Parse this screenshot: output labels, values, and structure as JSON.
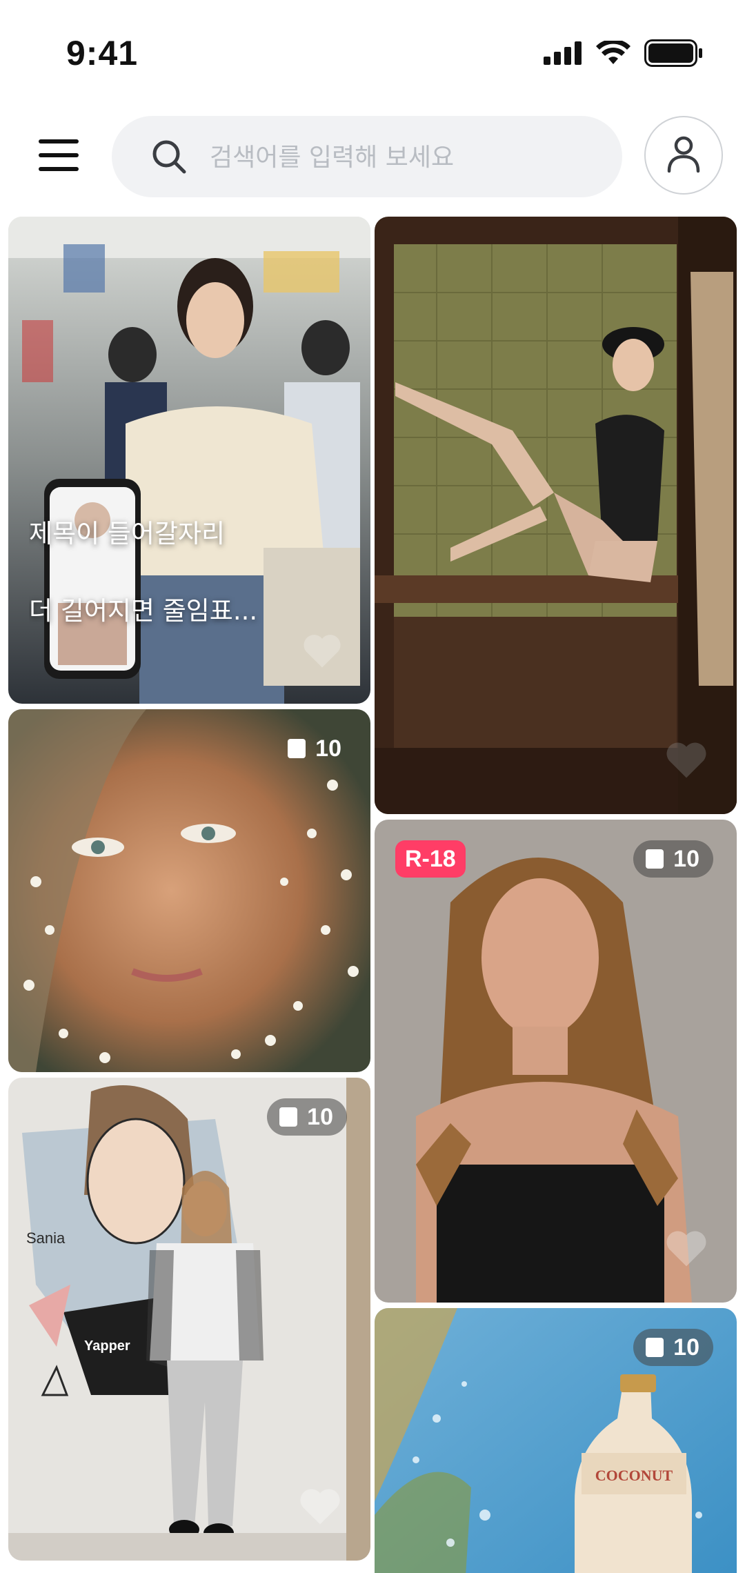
{
  "status": {
    "time": "9:41"
  },
  "search": {
    "placeholder": "검색어를 입력해 보세요"
  },
  "cards": [
    {
      "title_line1": "제목이 들어갈자리",
      "title_line2": "더 길어지면 줄임표...",
      "liked": false
    },
    {
      "liked": false
    },
    {
      "count": "10"
    },
    {
      "rating": "R-18",
      "count": "10",
      "liked": false
    },
    {
      "count": "10",
      "liked": false,
      "tshirt_text": "Yapper",
      "mural_text": "Sania"
    },
    {
      "count": "10",
      "label_text": "COCONUT"
    }
  ],
  "colors": {
    "accent_r18": "#ff3d66",
    "search_bg": "#f1f2f4",
    "placeholder": "#b8bcc2"
  }
}
